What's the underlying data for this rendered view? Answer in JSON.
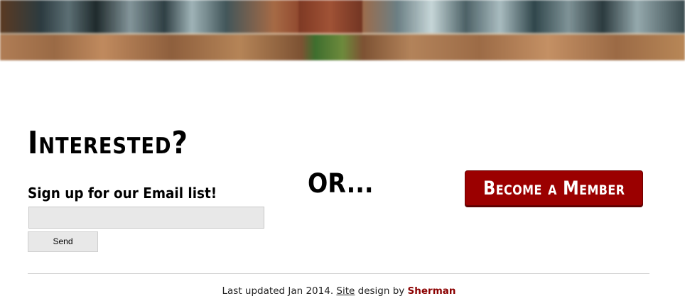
{
  "signup": {
    "heading": "Interested?",
    "subheading": "Sign up for our Email list!",
    "email_value": "",
    "send_label": "Send"
  },
  "or_text": "OR...",
  "member_button_label": "Become a Member",
  "footer": {
    "prefix": "Last updated Jan 2014. ",
    "site_link": "Site",
    "middle": " design by ",
    "author_link": "Sherman"
  },
  "colors": {
    "accent": "#9b0000",
    "author_link": "#8b0000"
  }
}
